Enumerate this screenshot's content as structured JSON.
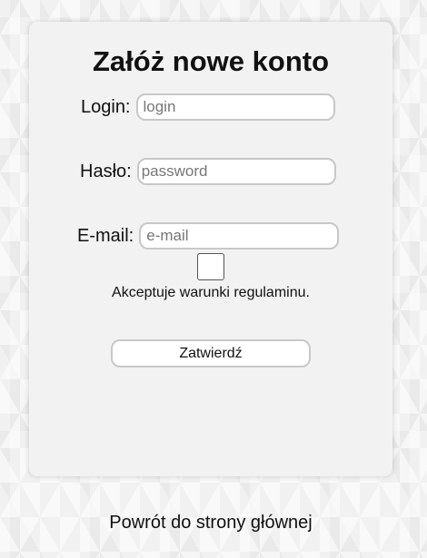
{
  "form": {
    "title": "Załóż nowe konto",
    "login": {
      "label": "Login:",
      "placeholder": "login",
      "value": ""
    },
    "password": {
      "label": "Hasło:",
      "placeholder": "password",
      "value": ""
    },
    "email": {
      "label": "E-mail:",
      "placeholder": "e-mail",
      "value": ""
    },
    "terms": {
      "checked": false,
      "label": "Akceptuje warunki regulaminu."
    },
    "submit_label": "Zatwierdź"
  },
  "footer": {
    "back_link": "Powrót do strony głównej"
  }
}
